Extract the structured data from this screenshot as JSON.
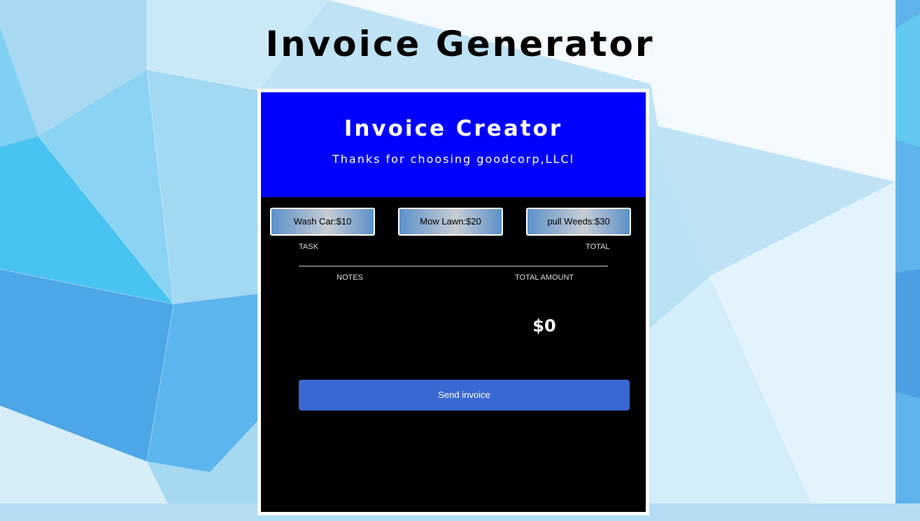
{
  "page": {
    "title": "Invoice Generator"
  },
  "card": {
    "title": "Invoice Creator",
    "subtitle": "Thanks for choosing goodcorp,LLCl",
    "header_color": "#0000ff"
  },
  "services": [
    {
      "label": "Wash Car:$10"
    },
    {
      "label": "Mow Lawn:$20"
    },
    {
      "label": "pull Weeds:$30"
    }
  ],
  "table": {
    "task_header": "TASK",
    "total_header": "TOTAL",
    "notes_header": "NOTES",
    "total_amount_header": "TOTAL AMOUNT",
    "total_amount": "$0"
  },
  "actions": {
    "send_label": "Send invoice",
    "send_color": "#3a68d3"
  }
}
